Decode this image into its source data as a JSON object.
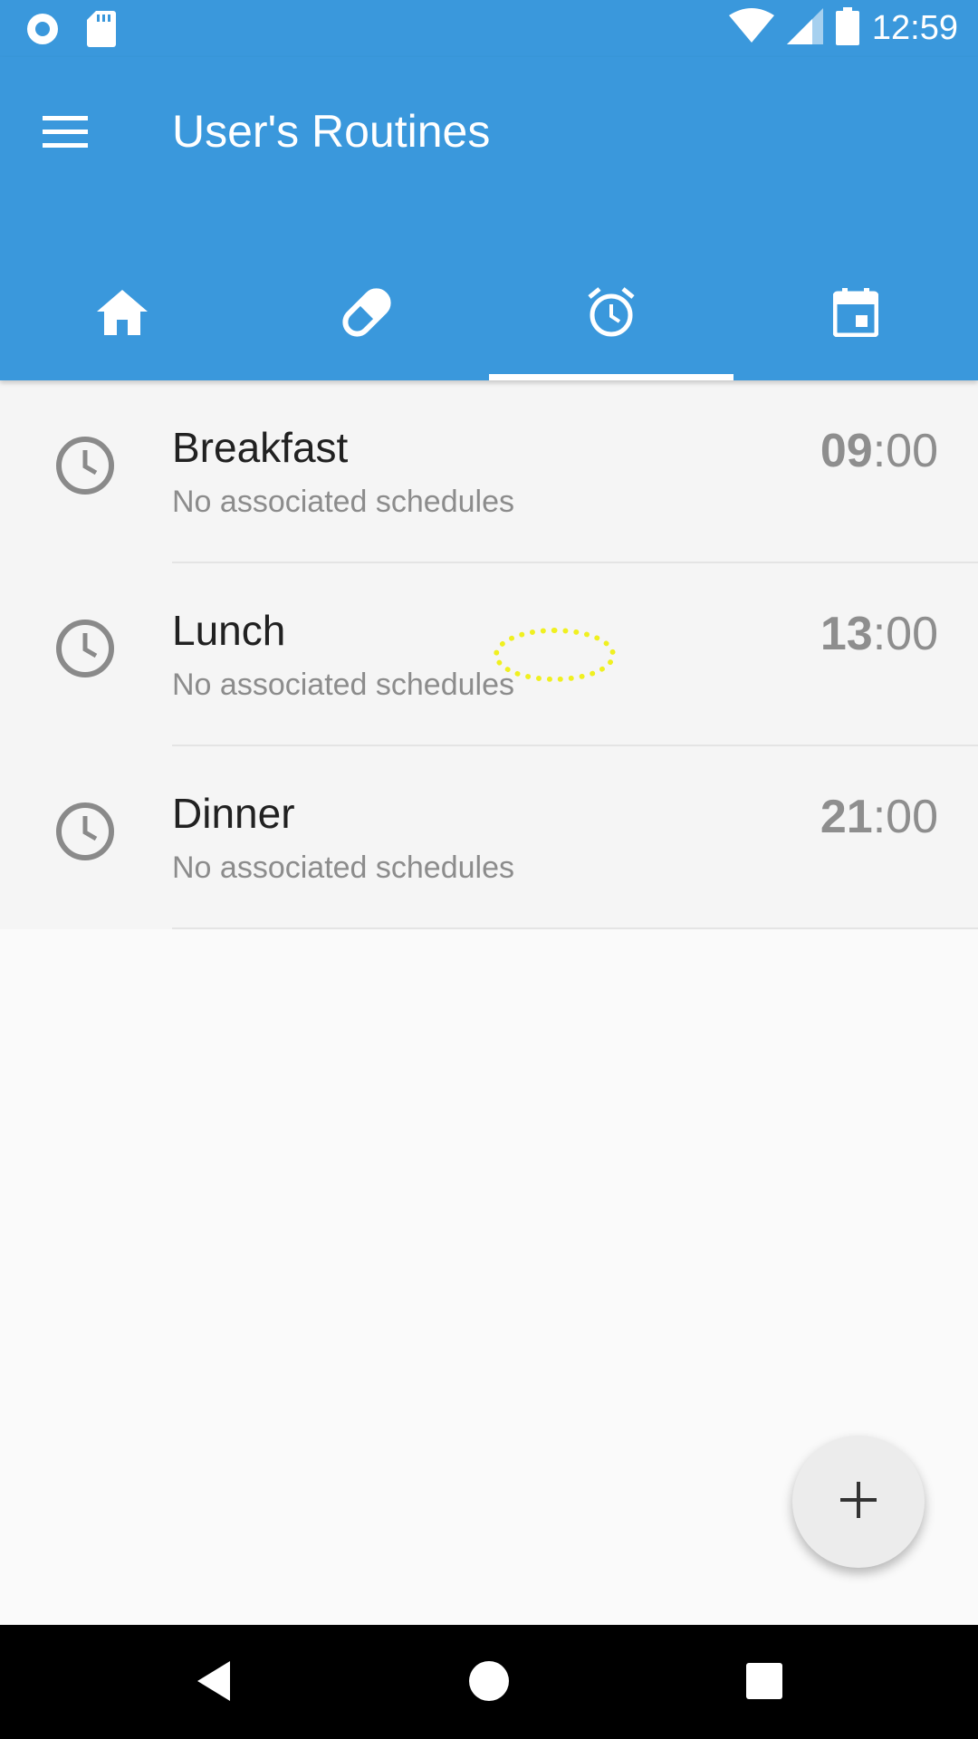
{
  "status_bar": {
    "time": "12:59",
    "left_icons": [
      "record-icon",
      "sd-card-icon"
    ],
    "right_icons": [
      "wifi-icon",
      "signal-icon",
      "battery-icon"
    ]
  },
  "app_bar": {
    "title": "User's Routines",
    "menu_icon": "menu-icon",
    "background_color": "#3a98dc"
  },
  "tabs": [
    {
      "name": "home",
      "icon": "home-icon",
      "selected": false
    },
    {
      "name": "medicines",
      "icon": "pill-icon",
      "selected": false
    },
    {
      "name": "routines",
      "icon": "alarm-icon",
      "selected": true
    },
    {
      "name": "calendar",
      "icon": "calendar-icon",
      "selected": false
    }
  ],
  "routines": [
    {
      "title": "Breakfast",
      "subtitle": "No associated schedules",
      "hour": "09",
      "minute": ":00",
      "icon": "clock-icon"
    },
    {
      "title": "Lunch",
      "subtitle": "No associated schedules",
      "hour": "13",
      "minute": ":00",
      "icon": "clock-icon"
    },
    {
      "title": "Dinner",
      "subtitle": "No associated schedules",
      "hour": "21",
      "minute": ":00",
      "icon": "clock-icon"
    }
  ],
  "fab": {
    "icon": "add-icon"
  },
  "nav_bar": {
    "buttons": [
      "back-icon",
      "home-circle-icon",
      "recents-icon"
    ]
  }
}
